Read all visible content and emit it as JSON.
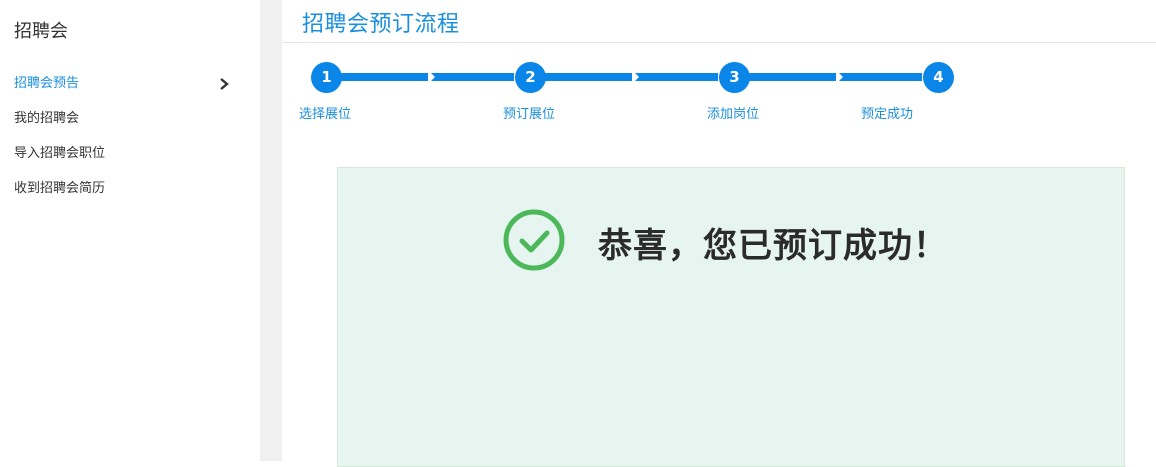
{
  "sidebar": {
    "title": "招聘会",
    "items": [
      {
        "label": "招聘会预告"
      },
      {
        "label": "我的招聘会"
      },
      {
        "label": "导入招聘会职位"
      },
      {
        "label": "收到招聘会简历"
      }
    ]
  },
  "main": {
    "title": "招聘会预订流程",
    "steps": [
      {
        "number": "1",
        "label": "选择展位"
      },
      {
        "number": "2",
        "label": "预订展位"
      },
      {
        "number": "3",
        "label": "添加岗位"
      },
      {
        "number": "4",
        "label": "预定成功"
      }
    ],
    "success_message": "恭喜，您已预订成功！"
  },
  "colors": {
    "accent": "#1a8fde",
    "progress": "#0a86e8",
    "success_green": "#4cb85a",
    "panel_bg": "#e6f5ef"
  },
  "icons": {
    "active_item": "chevron-right-icon",
    "success": "check-circle-icon"
  }
}
